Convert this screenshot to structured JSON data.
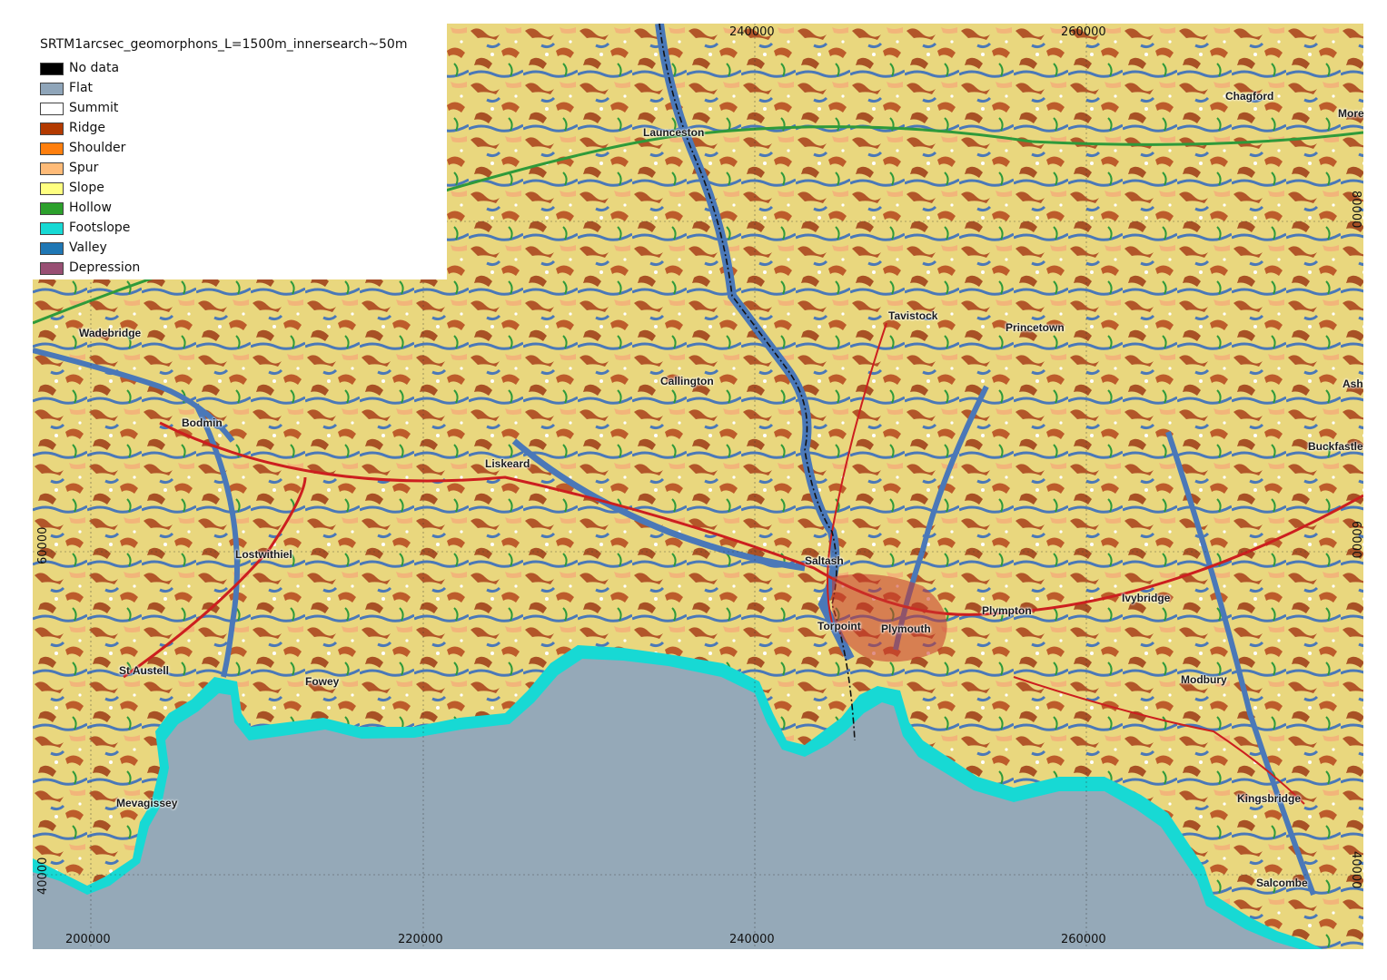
{
  "legend": {
    "title": "SRTM1arcsec_geomorphons_L=1500m_innersearch~50m",
    "items": [
      {
        "label": "No data",
        "color": "#000000"
      },
      {
        "label": "Flat",
        "color": "#8fa5b9"
      },
      {
        "label": "Summit",
        "color": "#ffffff"
      },
      {
        "label": "Ridge",
        "color": "#b33a00"
      },
      {
        "label": "Shoulder",
        "color": "#ff7f0e"
      },
      {
        "label": "Spur",
        "color": "#ffbb78"
      },
      {
        "label": "Slope",
        "color": "#ffff80"
      },
      {
        "label": "Hollow",
        "color": "#2ca02c"
      },
      {
        "label": "Footslope",
        "color": "#17d9d4"
      },
      {
        "label": "Valley",
        "color": "#1f77b4"
      },
      {
        "label": "Depression",
        "color": "#984f73"
      }
    ]
  },
  "grid": {
    "x_bottom": [
      "200000",
      "220000",
      "240000",
      "260000"
    ],
    "x_top": [
      "240000",
      "260000"
    ],
    "y_left": [
      "60000",
      "40000"
    ],
    "y_right": [
      "80000",
      "60000",
      "40000"
    ]
  },
  "places": [
    {
      "name": "Launceston"
    },
    {
      "name": "Chagford"
    },
    {
      "name": "More"
    },
    {
      "name": "Wadebridge"
    },
    {
      "name": "Tavistock"
    },
    {
      "name": "Princetown"
    },
    {
      "name": "Callington"
    },
    {
      "name": "Ash"
    },
    {
      "name": "Bodmin"
    },
    {
      "name": "Buckfastle"
    },
    {
      "name": "Liskeard"
    },
    {
      "name": "Lostwithiel"
    },
    {
      "name": "Saltash"
    },
    {
      "name": "Ivybridge"
    },
    {
      "name": "Plympton"
    },
    {
      "name": "Torpoint"
    },
    {
      "name": "Plymouth"
    },
    {
      "name": "St Austell"
    },
    {
      "name": "Fowey"
    },
    {
      "name": "Modbury"
    },
    {
      "name": "Mevagissey"
    },
    {
      "name": "Kingsbridge"
    },
    {
      "name": "Salcombe"
    }
  ],
  "colors": {
    "sea": "#95a9b8",
    "footslope": "#17d9d4",
    "land_slope": "#e9d77e",
    "ridge": "#a8401a",
    "valley": "#4a78b8",
    "road": "#cc1f1f",
    "hollow": "#2f9a3a"
  }
}
